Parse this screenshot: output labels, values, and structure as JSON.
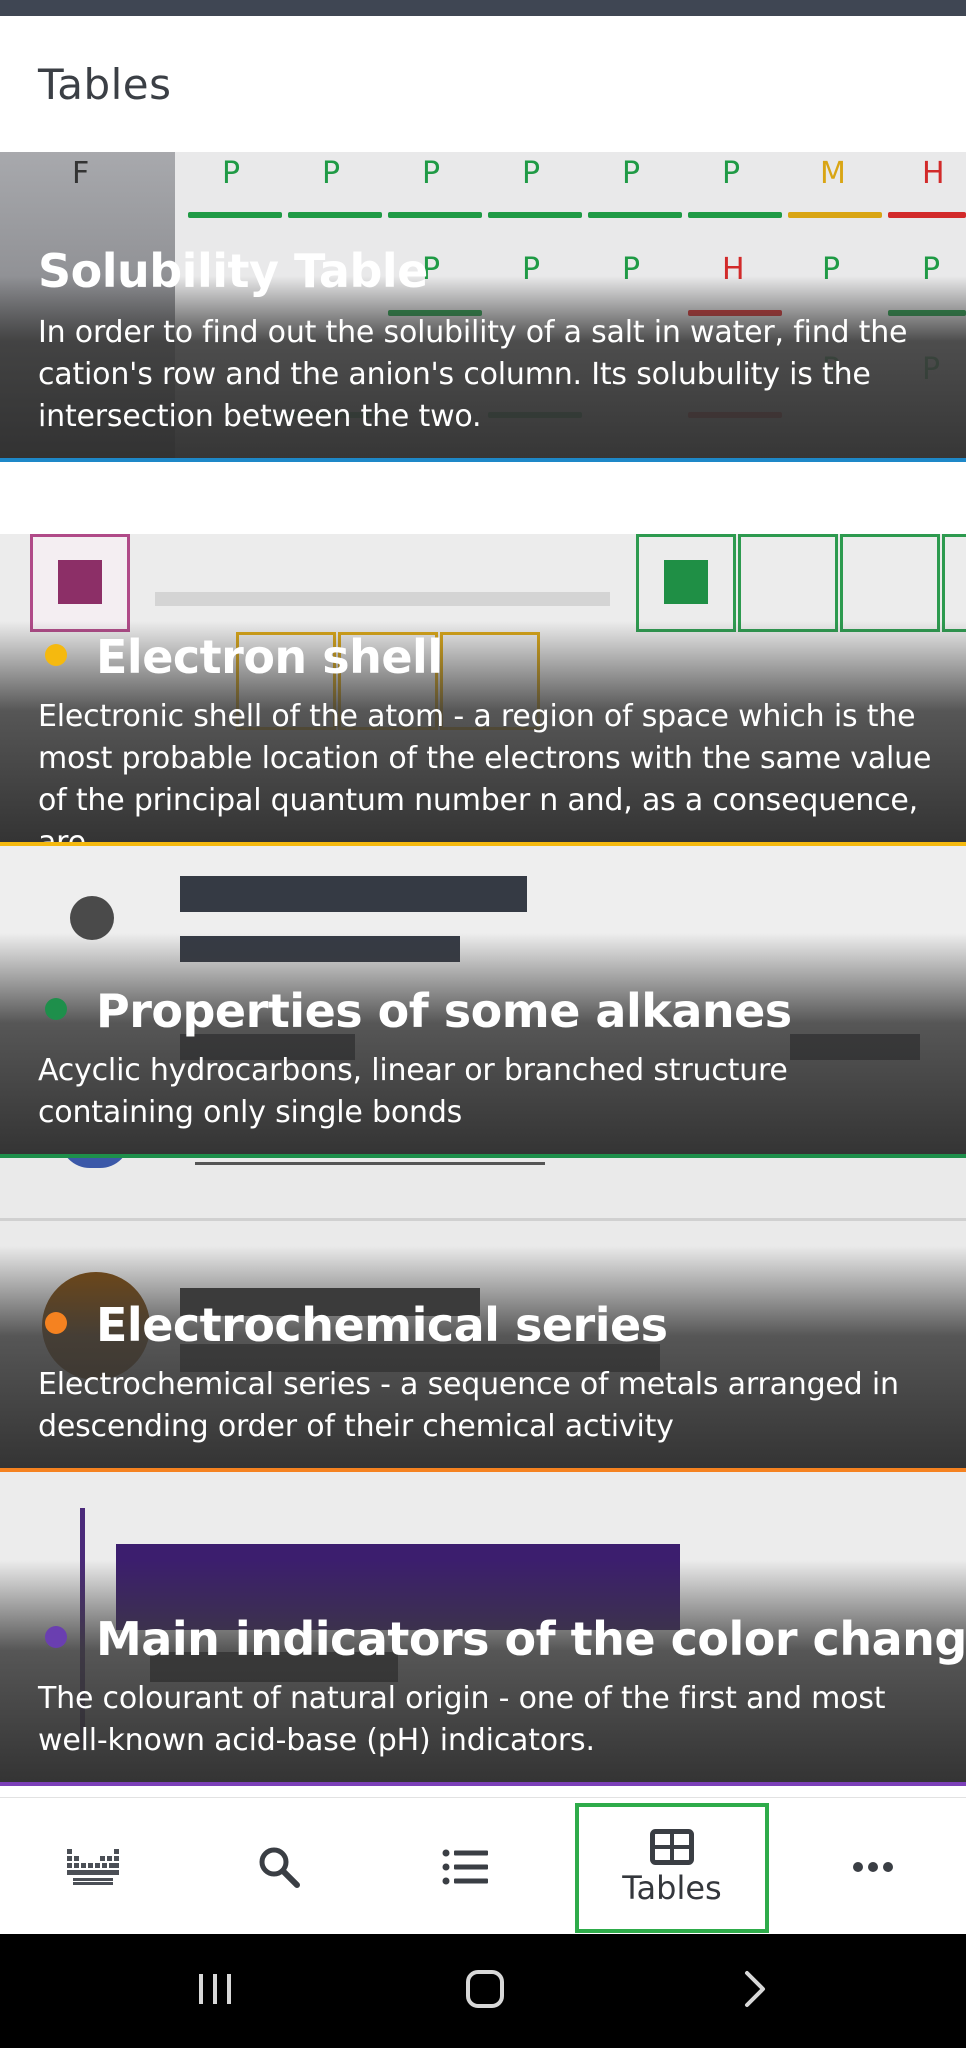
{
  "appbar": {
    "title": "Tables"
  },
  "cards": [
    {
      "title": "Solubility Table",
      "description": "In order to find out the solubility of a salt in water, find the cation's row and the anion's column. Its solubulity is the intersection between the two.",
      "accent_color": "#1e88c8",
      "background_cells": {
        "header_left": "F",
        "row1": [
          "P",
          "P",
          "P",
          "P",
          "P",
          "P",
          "M",
          "H"
        ],
        "row2": [
          "P",
          "P",
          "P",
          "H",
          "P",
          "P"
        ],
        "row3": [
          "P",
          "P"
        ]
      }
    },
    {
      "title": "Electron shell",
      "description": "Electronic shell of the atom - a region of space which is the most probable location of the electrons with the same value of the principal quantum number n and, as a consequence, are...",
      "dot_color": "#f5b90f",
      "accent_color": "#f5b90f"
    },
    {
      "title": "Properties of some alkanes",
      "description": "Acyclic hydrocarbons, linear or branched structure containing only single bonds",
      "dot_color": "#1e8f4b",
      "accent_color": "#1e8f4b"
    },
    {
      "title": "Electrochemical series",
      "description": "Electrochemical series - a sequence of metals arranged in descending order of their chemical activity",
      "dot_color": "#f58220",
      "accent_color": "#f58220"
    },
    {
      "title": "Main indicators of the color changes",
      "description": "The colourant of natural origin - one of the first and most well-known acid-base (pH) indicators.",
      "dot_color": "#6a3fb0",
      "accent_color": "#7b3fb8"
    }
  ],
  "bottom_nav": {
    "items": [
      {
        "icon": "periodic-table-icon",
        "label": ""
      },
      {
        "icon": "search-icon",
        "label": ""
      },
      {
        "icon": "list-icon",
        "label": ""
      },
      {
        "icon": "table-icon",
        "label": "Tables",
        "selected": true
      },
      {
        "icon": "more-icon",
        "label": ""
      }
    ],
    "selected_color": "#2eab4a"
  },
  "system_nav": {
    "items": [
      "recent-apps-icon",
      "home-icon",
      "back-icon"
    ]
  }
}
